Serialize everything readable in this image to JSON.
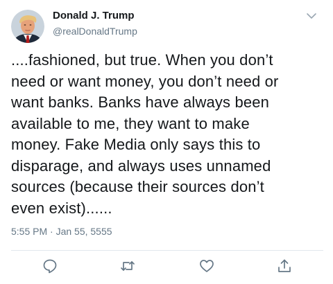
{
  "author": {
    "name": "Donald J. Trump",
    "handle": "@realDonaldTrump"
  },
  "tweet": {
    "text": "....fashioned, but true. When you don’t\nneed or want money, you don’t need or\nwant banks. Banks have always been\navailable to me, they want to make\nmoney. Fake Media only says this to\ndisparage, and always uses unnamed\nsources (because their sources don’t\neven exist)......",
    "timestamp": "5:55 PM · Jan 55, 5555"
  },
  "icons": {
    "menu": "chevron-down-icon",
    "reply": "reply-icon",
    "retweet": "retweet-icon",
    "like": "heart-icon",
    "share": "share-icon"
  },
  "colors": {
    "text_primary": "#14171a",
    "text_secondary": "#657786",
    "icon": "#657786",
    "divider": "#e1e8ed"
  }
}
